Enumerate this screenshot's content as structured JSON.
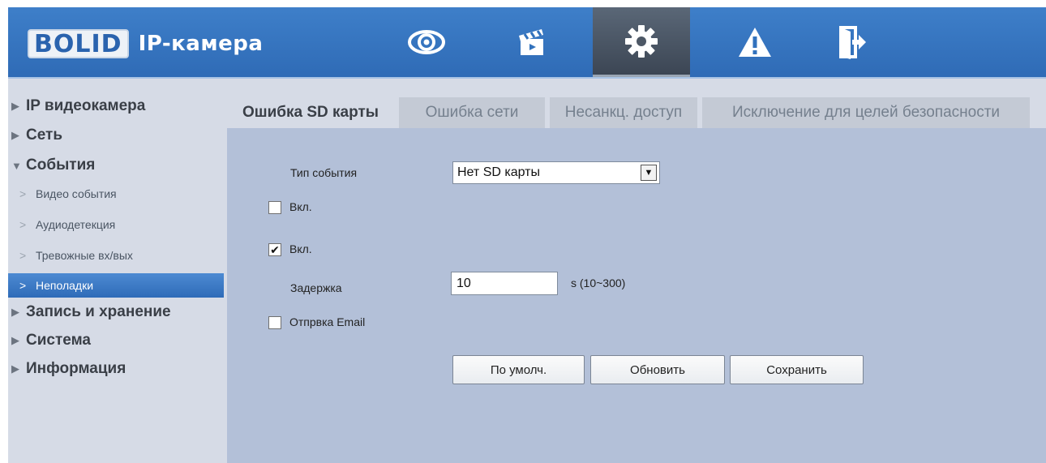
{
  "header": {
    "logo_text": "BOLID",
    "app_title": "IP-камера",
    "nav_icons": [
      "eye-icon",
      "clapperboard-icon",
      "gear-icon",
      "warning-icon",
      "exit-icon"
    ],
    "active_nav": "gear-icon",
    "colors": {
      "header_bg": "#3272bd",
      "accent": "#2e6bb8"
    }
  },
  "sidebar": {
    "items": [
      {
        "label": "IP видеокамера",
        "expanded": false
      },
      {
        "label": "Сеть",
        "expanded": false
      },
      {
        "label": "События",
        "expanded": true,
        "children": [
          {
            "label": "Видео события",
            "active": false
          },
          {
            "label": "Аудиодетекция",
            "active": false
          },
          {
            "label": "Тревожные вх/вых",
            "active": false
          },
          {
            "label": "Неполадки",
            "active": true
          }
        ]
      },
      {
        "label": "Запись и хранение",
        "expanded": false
      },
      {
        "label": "Система",
        "expanded": false
      },
      {
        "label": "Информация",
        "expanded": false
      }
    ]
  },
  "tabs": [
    {
      "label": "Ошибка SD карты",
      "active": true
    },
    {
      "label": "Ошибка сети",
      "active": false
    },
    {
      "label": "Несанкц. доступ",
      "active": false
    },
    {
      "label": "Исключение для целей безопасности",
      "active": false
    }
  ],
  "form": {
    "event_type_label": "Тип события",
    "event_type_value": "Нет SD карты",
    "enable1_label": "Вкл.",
    "enable1_checked": false,
    "enable2_label": "Вкл.",
    "enable2_checked": true,
    "delay_label": "Задержка",
    "delay_value": "10",
    "delay_hint": "s (10~300)",
    "email_label": "Отпрвка Email",
    "email_checked": false
  },
  "buttons": {
    "default_label": "По умолч.",
    "refresh_label": "Обновить",
    "save_label": "Сохранить"
  }
}
